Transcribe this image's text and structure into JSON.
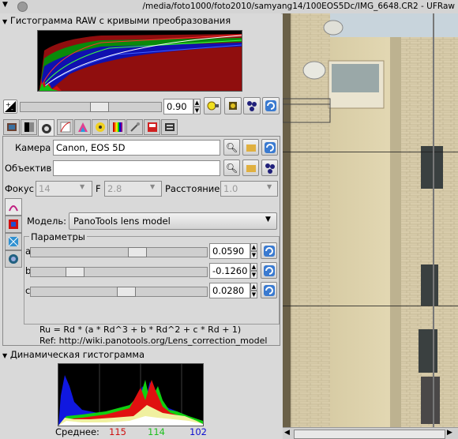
{
  "window": {
    "title": "/media/foto1000/foto2010/samyang14/100EOS5Dc/IMG_6648.CR2 - UFRaw"
  },
  "raw_hist": {
    "title": "Гистограмма RAW с кривыми преобразования"
  },
  "exposure": {
    "value": "0.90"
  },
  "camera": {
    "label": "Камера",
    "value": "Canon, EOS 5D"
  },
  "lens": {
    "label": "Объектив",
    "value": ""
  },
  "focus": {
    "label": "Фокус",
    "value": "14",
    "f_label": "F",
    "f_value": "2.8",
    "dist_label": "Расстояние",
    "dist_value": "1.0"
  },
  "model": {
    "label": "Модель:",
    "value": "PanoTools lens model"
  },
  "params": {
    "title": "Параметры",
    "items": [
      {
        "name": "a",
        "value": "0.0590",
        "level": 0.62
      },
      {
        "name": "b",
        "value": "-0.1260",
        "level": 0.22
      },
      {
        "name": "c",
        "value": "0.0280",
        "level": 0.55
      }
    ]
  },
  "formula": {
    "line1": "Ru = Rd * (a * Rd^3 + b * Rd^2 + c * Rd + 1)",
    "line2": "Ref: http://wiki.panotools.org/Lens_correction_model"
  },
  "live_hist": {
    "title": "Динамическая гистограмма"
  },
  "stats": {
    "label": "Среднее:",
    "r": "115",
    "g": "114",
    "b": "102",
    "r_color": "#d01010",
    "g_color": "#1fc01f",
    "b_color": "#1010d0"
  }
}
